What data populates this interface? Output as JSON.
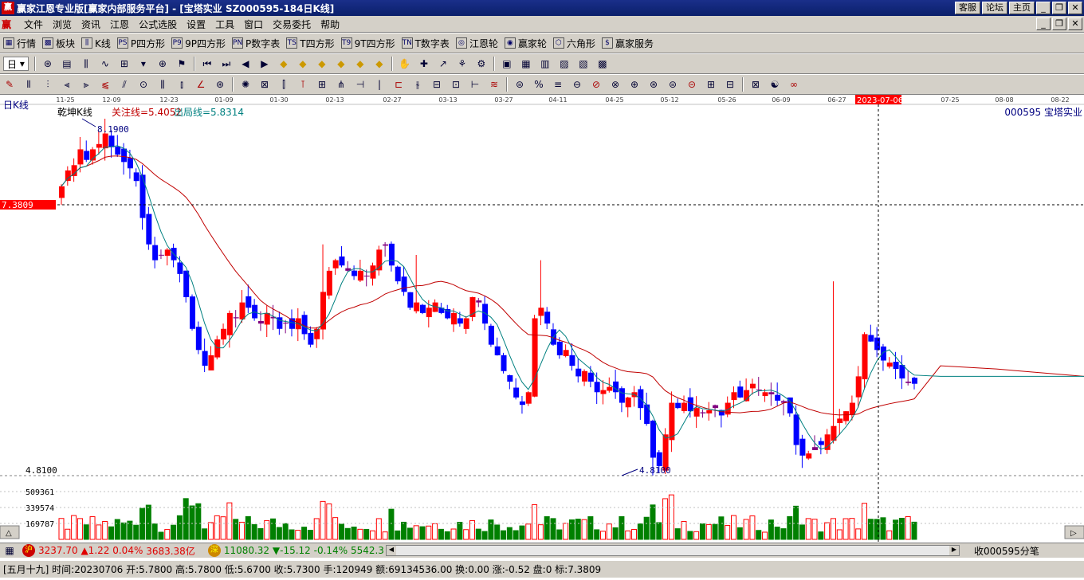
{
  "window": {
    "icon": "赢",
    "title": "赢家江恩专业版[赢家内部服务平台] - [宝塔实业  SZ000595-184日K线]",
    "buttons": [
      "客服",
      "论坛",
      "主页"
    ]
  },
  "menu": {
    "items": [
      "文件",
      "浏览",
      "资讯",
      "江恩",
      "公式选股",
      "设置",
      "工具",
      "窗口",
      "交易委托",
      "帮助"
    ]
  },
  "toolbar1": [
    {
      "icon": "grid-icon",
      "glyph": "▦",
      "label": "行情"
    },
    {
      "icon": "blocks-icon",
      "glyph": "▩",
      "label": "板块"
    },
    {
      "icon": "kline-icon",
      "glyph": "⫼",
      "label": "K线"
    },
    {
      "icon": "ps-icon",
      "glyph": "PS",
      "label": "P四方形"
    },
    {
      "icon": "p9-icon",
      "glyph": "P9",
      "label": "9P四方形"
    },
    {
      "icon": "pn-icon",
      "glyph": "PN",
      "label": "P数字表"
    },
    {
      "icon": "ts-icon",
      "glyph": "TS",
      "label": "T四方形"
    },
    {
      "icon": "t9-icon",
      "glyph": "T9",
      "label": "9T四方形"
    },
    {
      "icon": "tn-icon",
      "glyph": "TN",
      "label": "T数字表"
    },
    {
      "icon": "wheel-icon",
      "glyph": "◎",
      "label": "江恩轮"
    },
    {
      "icon": "winner-wheel-icon",
      "glyph": "◉",
      "label": "赢家轮"
    },
    {
      "icon": "hexagon-icon",
      "glyph": "⬡",
      "label": "六角形"
    },
    {
      "icon": "dollar-icon",
      "glyph": "$",
      "label": "赢家服务"
    }
  ],
  "toolbar2": [
    "日"
  ],
  "chart": {
    "period_label": "日K线",
    "indicator_name": "乾坤K线",
    "attention_line": "关注线=5.4052",
    "exit_line": "出局线=5.8314",
    "stock": "000595  宝塔实业",
    "high_label": "8.1900",
    "low_label": "4.8100",
    "axis_low": "4.8100",
    "crosshair_price": "7.3809",
    "crosshair_date": "2023-07-06",
    "dates": [
      "11-25",
      "12-09",
      "12-23",
      "01-09",
      "01-30",
      "02-13",
      "02-27",
      "03-13",
      "03-27",
      "04-11",
      "04-25",
      "05-12",
      "05-26",
      "06-09",
      "06-27",
      "",
      "07-25",
      "08-08",
      "08-22"
    ],
    "vol_labels": [
      "509361",
      "339574",
      "169787"
    ],
    "colors": {
      "up": "#ff0000",
      "down": "#0000ff",
      "flat": "#800080",
      "ma1": "#008080",
      "ma2": "#c00000",
      "vol_up": "#ff0000",
      "vol_down": "#008000"
    }
  },
  "chart_data": {
    "type": "candlestick",
    "price_range": [
      4.81,
      8.19
    ],
    "closes": [
      7.55,
      7.7,
      7.75,
      7.9,
      7.8,
      7.9,
      7.95,
      8.05,
      7.92,
      7.85,
      7.78,
      7.72,
      7.6,
      7.25,
      7.0,
      6.85,
      6.9,
      6.95,
      6.85,
      6.72,
      6.5,
      6.2,
      6.0,
      5.85,
      5.95,
      6.1,
      6.2,
      6.35,
      6.3,
      6.45,
      6.4,
      6.3,
      6.25,
      6.35,
      6.3,
      6.2,
      6.25,
      6.2,
      6.3,
      6.15,
      6.05,
      6.2,
      6.55,
      6.75,
      6.85,
      6.8,
      6.75,
      6.7,
      6.75,
      6.7,
      6.8,
      6.95,
      7.0,
      6.8,
      6.65,
      6.55,
      6.4,
      6.45,
      6.35,
      6.4,
      6.45,
      6.35,
      6.3,
      6.35,
      6.25,
      6.3,
      6.5,
      6.45,
      6.25,
      6.05,
      5.95,
      5.8,
      5.7,
      5.55,
      5.48,
      5.6,
      6.3,
      6.4,
      6.25,
      6.05,
      5.95,
      6.0,
      5.85,
      5.75,
      5.8,
      5.7,
      5.6,
      5.62,
      5.65,
      5.6,
      5.5,
      5.55,
      5.6,
      5.45,
      5.3,
      4.98,
      4.9,
      5.2,
      5.5,
      5.45,
      5.5,
      5.42,
      5.45,
      5.4,
      5.43,
      5.45,
      5.38,
      5.5,
      5.6,
      5.55,
      5.62,
      5.68,
      5.62,
      5.6,
      5.58,
      5.52,
      5.5,
      5.4,
      5.1,
      5.0,
      5.02,
      5.08,
      5.1,
      5.2,
      5.28,
      5.35,
      5.42,
      5.5,
      5.75,
      6.15,
      6.08,
      6.0,
      5.9,
      5.88,
      5.82,
      5.73,
      5.7,
      5.68
    ],
    "volume_max": 679148,
    "ma_short_note": "teal",
    "ma_long_note": "red"
  },
  "status": {
    "sh_icon": "沪",
    "sh_price": "3237.70",
    "sh_change": "▲1.22",
    "sh_pct": "0.04%",
    "sh_amount": "3683.38亿",
    "sz_icon": "深",
    "sz_price": "11080.32",
    "sz_change": "▼-15.12",
    "sz_pct": "-0.14%",
    "sz_amount": "5542.3",
    "right_label": "收000595分笔"
  },
  "info": {
    "text": "[五月十九] 时间:20230706 开:5.7800 高:5.7800 低:5.6700 收:5.7300 手:120949 额:69134536.00 换:0.00 涨:-0.52 盘:0 标:7.3809"
  }
}
